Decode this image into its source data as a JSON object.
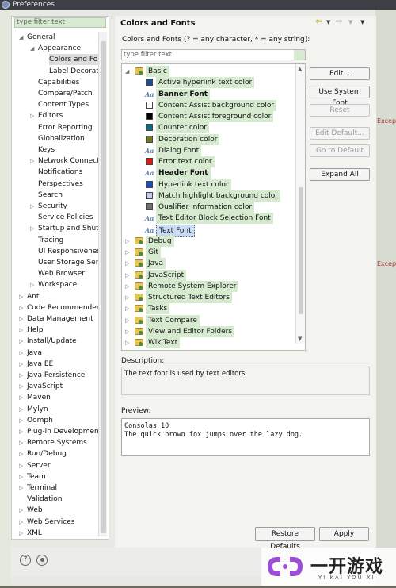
{
  "window": {
    "title": "Preferences"
  },
  "left": {
    "filter_placeholder": "type filter text",
    "tree": [
      {
        "label": "General",
        "level": 0,
        "arrow": "▲"
      },
      {
        "label": "Appearance",
        "level": 1,
        "arrow": "▲"
      },
      {
        "label": "Colors and Fonts",
        "level": 2,
        "arrow": "",
        "selected": true
      },
      {
        "label": "Label Decorations",
        "level": 2,
        "arrow": ""
      },
      {
        "label": "Capabilities",
        "level": 1,
        "arrow": ""
      },
      {
        "label": "Compare/Patch",
        "level": 1,
        "arrow": ""
      },
      {
        "label": "Content Types",
        "level": 1,
        "arrow": ""
      },
      {
        "label": "Editors",
        "level": 1,
        "arrow": "▷"
      },
      {
        "label": "Error Reporting",
        "level": 1,
        "arrow": ""
      },
      {
        "label": "Globalization",
        "level": 1,
        "arrow": ""
      },
      {
        "label": "Keys",
        "level": 1,
        "arrow": ""
      },
      {
        "label": "Network Connections",
        "level": 1,
        "arrow": "▷"
      },
      {
        "label": "Notifications",
        "level": 1,
        "arrow": ""
      },
      {
        "label": "Perspectives",
        "level": 1,
        "arrow": ""
      },
      {
        "label": "Search",
        "level": 1,
        "arrow": ""
      },
      {
        "label": "Security",
        "level": 1,
        "arrow": "▷"
      },
      {
        "label": "Service Policies",
        "level": 1,
        "arrow": ""
      },
      {
        "label": "Startup and Shutdown",
        "level": 1,
        "arrow": "▷"
      },
      {
        "label": "Tracing",
        "level": 1,
        "arrow": ""
      },
      {
        "label": "UI Responsiveness",
        "level": 1,
        "arrow": ""
      },
      {
        "label": "User Storage Service",
        "level": 1,
        "arrow": ""
      },
      {
        "label": "Web Browser",
        "level": 1,
        "arrow": ""
      },
      {
        "label": "Workspace",
        "level": 1,
        "arrow": "▷"
      },
      {
        "label": "Ant",
        "level": 0,
        "arrow": "▷"
      },
      {
        "label": "Code Recommenders",
        "level": 0,
        "arrow": "▷"
      },
      {
        "label": "Data Management",
        "level": 0,
        "arrow": "▷"
      },
      {
        "label": "Help",
        "level": 0,
        "arrow": "▷"
      },
      {
        "label": "Install/Update",
        "level": 0,
        "arrow": "▷"
      },
      {
        "label": "Java",
        "level": 0,
        "arrow": "▷"
      },
      {
        "label": "Java EE",
        "level": 0,
        "arrow": "▷"
      },
      {
        "label": "Java Persistence",
        "level": 0,
        "arrow": "▷"
      },
      {
        "label": "JavaScript",
        "level": 0,
        "arrow": "▷"
      },
      {
        "label": "Maven",
        "level": 0,
        "arrow": "▷"
      },
      {
        "label": "Mylyn",
        "level": 0,
        "arrow": "▷"
      },
      {
        "label": "Oomph",
        "level": 0,
        "arrow": "▷"
      },
      {
        "label": "Plug-in Development",
        "level": 0,
        "arrow": "▷"
      },
      {
        "label": "Remote Systems",
        "level": 0,
        "arrow": "▷"
      },
      {
        "label": "Run/Debug",
        "level": 0,
        "arrow": "▷"
      },
      {
        "label": "Server",
        "level": 0,
        "arrow": "▷"
      },
      {
        "label": "Team",
        "level": 0,
        "arrow": "▷"
      },
      {
        "label": "Terminal",
        "level": 0,
        "arrow": "▷"
      },
      {
        "label": "Validation",
        "level": 0,
        "arrow": ""
      },
      {
        "label": "Web",
        "level": 0,
        "arrow": "▷"
      },
      {
        "label": "Web Services",
        "level": 0,
        "arrow": "▷"
      },
      {
        "label": "XML",
        "level": 0,
        "arrow": "▷"
      }
    ]
  },
  "right": {
    "title": "Colors and Fonts",
    "subtitle": "Colors and Fonts (? = any character, * = any string):",
    "filter_placeholder": "type filter text",
    "basic_label": "Basic",
    "basic_items": [
      {
        "label": "Active hyperlink text color",
        "kind": "color",
        "color": "#1d4f8f"
      },
      {
        "label": "Banner Font",
        "kind": "font",
        "bold": true
      },
      {
        "label": "Content Assist background color",
        "kind": "color",
        "color": "#ffffff"
      },
      {
        "label": "Content Assist foreground color",
        "kind": "color",
        "color": "#000000"
      },
      {
        "label": "Counter color",
        "kind": "color",
        "color": "#0f6a80"
      },
      {
        "label": "Decoration color",
        "kind": "color",
        "color": "#6f7a2a"
      },
      {
        "label": "Dialog Font",
        "kind": "font",
        "bold": false
      },
      {
        "label": "Error text color",
        "kind": "color",
        "color": "#e01818"
      },
      {
        "label": "Header Font",
        "kind": "font",
        "bold": true
      },
      {
        "label": "Hyperlink text color",
        "kind": "color",
        "color": "#1a4fb8"
      },
      {
        "label": "Match highlight background color",
        "kind": "color",
        "color": "#c8cfee"
      },
      {
        "label": "Qualifier information color",
        "kind": "color",
        "color": "#707070"
      },
      {
        "label": "Text Editor Block Selection Font",
        "kind": "font",
        "mono": true
      },
      {
        "label": "Text Font",
        "kind": "font",
        "selected": true
      }
    ],
    "groups": [
      "Debug",
      "Git",
      "Java",
      "JavaScript",
      "Remote System Explorer",
      "Structured Text Editors",
      "Tasks",
      "Text Compare",
      "View and Editor Folders",
      "WikiText"
    ],
    "buttons": {
      "edit": "Edit...",
      "use_system_font": "Use System Font",
      "reset": "Reset",
      "edit_default": "Edit Default...",
      "go_to_default": "Go to Default",
      "expand_all": "Expand All"
    },
    "description_label": "Description:",
    "description_text": "The text font is used by text editors.",
    "preview_label": "Preview:",
    "preview_line1": "Consolas 10",
    "preview_line2": "The quick brown fox jumps over the lazy dog.",
    "restore_defaults": "Restore Defaults",
    "apply": "Apply"
  },
  "background": {
    "right_edge_text_1": "Except",
    "right_edge_text_2": "Excep"
  },
  "watermark": {
    "main": "一开游戏",
    "sub": "YI KAI YOU XI"
  }
}
